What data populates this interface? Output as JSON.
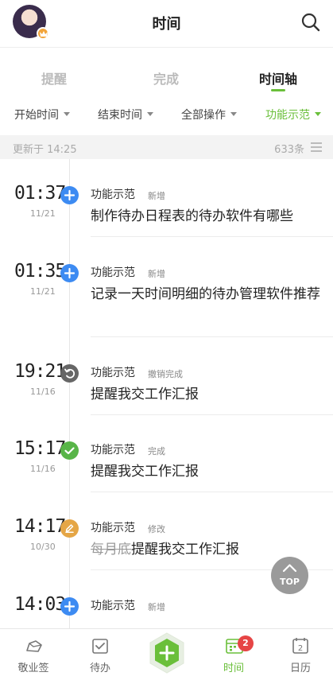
{
  "header": {
    "title": "时间",
    "avatar": "avatar",
    "search_icon": "search-icon"
  },
  "tabs": [
    {
      "label": "提醒",
      "active": false
    },
    {
      "label": "完成",
      "active": false
    },
    {
      "label": "时间轴",
      "active": true
    }
  ],
  "filters": [
    {
      "label": "开始时间",
      "active": false
    },
    {
      "label": "结束时间",
      "active": false
    },
    {
      "label": "全部操作",
      "active": false
    },
    {
      "label": "功能示范",
      "active": true
    }
  ],
  "status": {
    "updated": "更新于 14:25",
    "count": "633条"
  },
  "entries": [
    {
      "time": "01:37",
      "date": "11/21",
      "project": "功能示范",
      "action": "新增",
      "icon": "plus-icon",
      "color": "#3d8bf2",
      "text": "制作待办日程表的待办软件有哪些"
    },
    {
      "time": "01:35",
      "date": "11/21",
      "project": "功能示范",
      "action": "新增",
      "icon": "plus-icon",
      "color": "#3d8bf2",
      "text": "记录一天时间明细的待办管理软件推荐"
    },
    {
      "time": "19:21",
      "date": "11/16",
      "project": "功能示范",
      "action": "撤销完成",
      "icon": "undo-icon",
      "color": "#666666",
      "text": "提醒我交工作汇报"
    },
    {
      "time": "15:17",
      "date": "11/16",
      "project": "功能示范",
      "action": "完成",
      "icon": "check-icon",
      "color": "#58b548",
      "text": "提醒我交工作汇报"
    },
    {
      "time": "14:17",
      "date": "10/30",
      "project": "功能示范",
      "action": "修改",
      "icon": "edit-icon",
      "color": "#e5a646",
      "text_old": "每月底",
      "text": "提醒我交工作汇报"
    },
    {
      "time": "14:03",
      "date": "",
      "project": "功能示范",
      "action": "新增",
      "icon": "plus-icon",
      "color": "#3d8bf2",
      "text": ""
    }
  ],
  "top_button": {
    "label": "TOP"
  },
  "bottom_nav": [
    {
      "label": "敬业签",
      "icon": "cloud-note-icon",
      "active": false
    },
    {
      "label": "待办",
      "icon": "todo-check-icon",
      "active": false
    },
    {
      "label": "",
      "icon": "add-hexagon-icon",
      "active": false
    },
    {
      "label": "时间",
      "icon": "calendar-timeline-icon",
      "active": true,
      "badge": "2"
    },
    {
      "label": "日历",
      "icon": "calendar-icon",
      "active": false,
      "day": "2"
    }
  ],
  "colors": {
    "accent": "#6abf3a",
    "badge": "#e64545"
  }
}
